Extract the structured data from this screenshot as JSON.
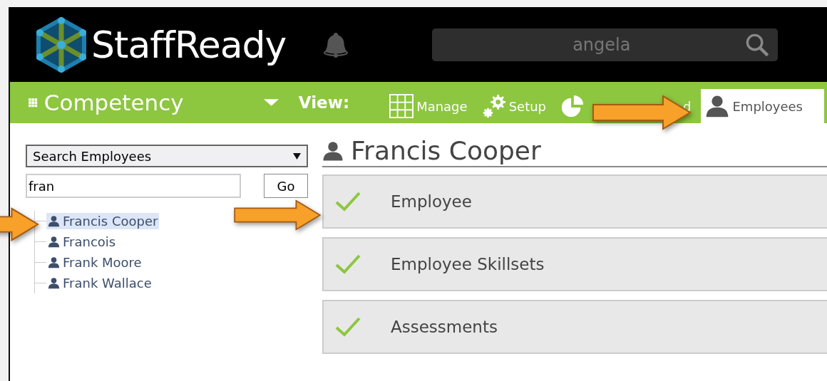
{
  "header": {
    "logo_text": "StaffReady",
    "search": {
      "value": "angela"
    }
  },
  "module_bar": {
    "title": "Competency",
    "view_label": "View:",
    "tabs": [
      {
        "label": "Manage",
        "kind": "grid",
        "selected": false
      },
      {
        "label": "Setup",
        "kind": "gears",
        "selected": false
      },
      {
        "label": "d",
        "kind": "pie",
        "selected": false
      },
      {
        "label": "Employees",
        "kind": "person",
        "selected": true
      }
    ]
  },
  "sidebar": {
    "search_type": "Search Employees",
    "query": "fran",
    "go_button": "Go",
    "results": [
      {
        "name": "Francis Cooper",
        "selected": true
      },
      {
        "name": "Francois",
        "selected": false
      },
      {
        "name": "Frank Moore",
        "selected": false
      },
      {
        "name": "Frank Wallace",
        "selected": false
      }
    ]
  },
  "employee": {
    "name": "Francis Cooper",
    "sections": [
      {
        "title": "Employee",
        "complete": true
      },
      {
        "title": "Employee Skillsets",
        "complete": true
      },
      {
        "title": "Assessments",
        "complete": true
      }
    ]
  }
}
